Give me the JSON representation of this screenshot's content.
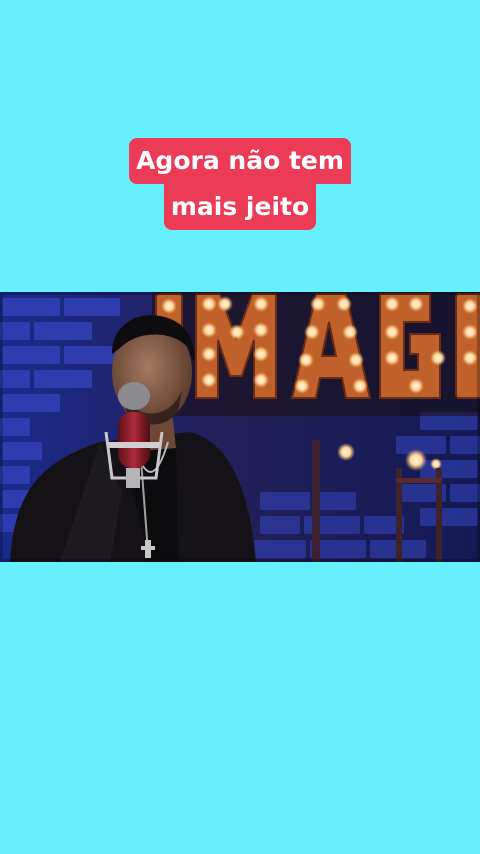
{
  "caption": {
    "lines": [
      "Agora não tem",
      "mais jeito"
    ]
  },
  "video": {
    "description_icon": "music-video-still",
    "sign_text": "IMAGE",
    "colors": {
      "page_background": "#66f0fd",
      "caption_background": "#ec3b56",
      "caption_text": "#ffffff",
      "brick_blue": "#2d3aa8",
      "sign_orange": "#c0602a"
    }
  }
}
